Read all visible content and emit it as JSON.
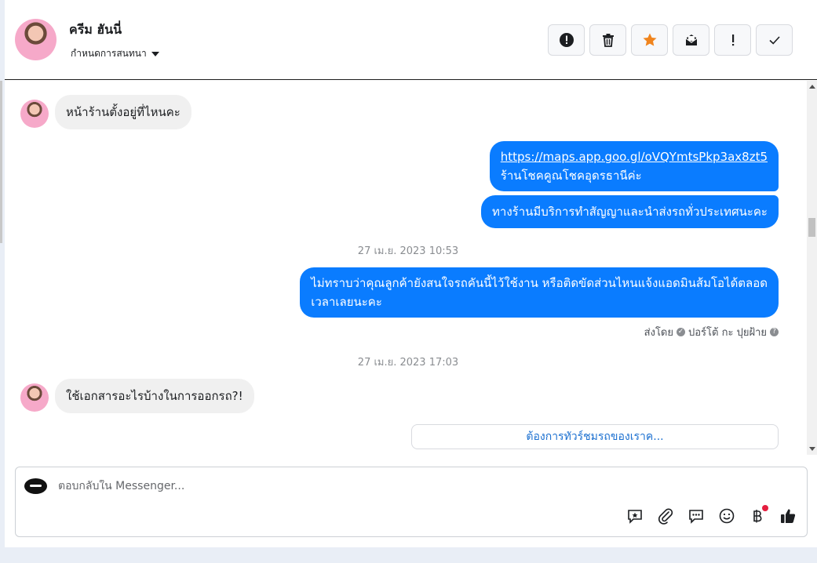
{
  "header": {
    "contact_name": "ครีม ฮันนี่",
    "assign_label": "กำหนดการสนทนา",
    "actions": [
      {
        "name": "report-button",
        "icon": "alert-circle-icon"
      },
      {
        "name": "delete-button",
        "icon": "trash-icon"
      },
      {
        "name": "star-button",
        "icon": "star-icon"
      },
      {
        "name": "mark-unread-button",
        "icon": "envelope-icon"
      },
      {
        "name": "important-button",
        "icon": "exclamation-icon"
      },
      {
        "name": "done-button",
        "icon": "check-icon"
      }
    ]
  },
  "messages": {
    "m1": "หน้าร้านตั้งอยู่ที่ไหนคะ",
    "m2_link": "https://maps.app.goo.gl/oVQYmtsPkp3ax8zt5",
    "m2_text": "ร้านโชคคูณโชคอุดรธานีค่ะ",
    "m3": "ทางร้านมีบริการทำสัญญาและนำส่งรถทั่วประเทศนะคะ",
    "ts1": "27 เม.ย. 2023 10:53",
    "m4_line1": "ไม่ทราบว่าคุณลูกค้ายังสนใจรถคันนี้ไว้ใช้งาน หรือติดขัดส่วนไหนแจ้งแอดมินส้มโอได้ตลอด",
    "m4_line2": "เวลาเลยนะคะ",
    "sent_by_label": "ส่งโดย",
    "sent_by_name": "ปอร์โต้ กะ ปุยฝ้าย",
    "ts2": "27 เม.ย. 2023 17:03",
    "m5": "ใช้เอกสารอะไรบ้างในการออกรถ?!",
    "suggestion": "ต้องการทัวร์ชมรถของเราค..."
  },
  "composer": {
    "placeholder": "ตอบกลับใน Messenger..."
  },
  "colors": {
    "outgoing": "#0a7cff",
    "incoming": "#f0f0f0",
    "star": "#f0841d"
  }
}
